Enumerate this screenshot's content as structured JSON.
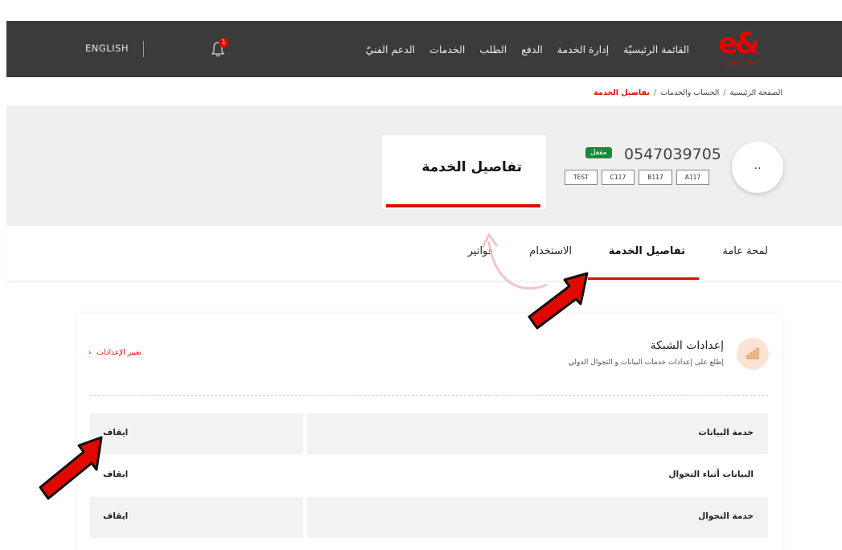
{
  "header": {
    "logo_mark": "e&",
    "logo_sub": "الحالات والمزيد",
    "nav": [
      "القائمة الرئيسيّة",
      "إدارة الخدمة",
      "الدفع",
      "الطلب",
      "الخدمات",
      "الدعم الفنيّ"
    ],
    "notification_count": "1",
    "language": "ENGLISH"
  },
  "breadcrumb": {
    "home": "الصفحة الرئيسية",
    "account": "الحساب والخدمات",
    "current": "تفاصيل الخدمة",
    "separator": "/"
  },
  "hero": {
    "avatar_text": "..",
    "phone": "0547039705",
    "status": "مفعل",
    "tags": [
      "A117",
      "B117",
      "C117",
      "TEST"
    ],
    "card_title": "تفاصيل الخدمة"
  },
  "tabs": [
    "لمحة عامة",
    "تفاصيل الخدمة",
    "الاستخدام",
    "فواتير"
  ],
  "section": {
    "title": "إعدادات الشبكة",
    "subtitle": "إطلع على إعدادات خدمات البيانات و التجوال الدولي",
    "change_link": "تغيير الإعدادات",
    "rows": [
      {
        "label": "خدمة البيانات",
        "value": "ايقاف"
      },
      {
        "label": "البيانات أثناء التجوال",
        "value": "ايقاف"
      },
      {
        "label": "خدمة التجوال",
        "value": "ايقاف"
      }
    ]
  },
  "colors": {
    "brand": "#e00800",
    "header_bg": "#3b3b3b",
    "hero_bg": "#efefed",
    "status_green": "#1a8a3a"
  }
}
